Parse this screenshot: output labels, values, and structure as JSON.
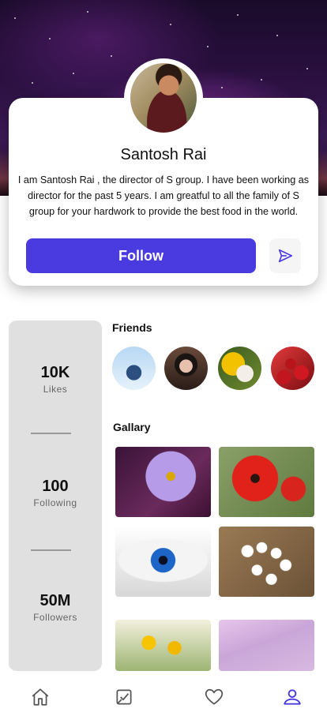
{
  "profile": {
    "name": "Santosh Rai",
    "bio": "I am Santosh Rai , the director of S group. I have been working as director for the past 5 years. I am greatful to all the family of S group for your hardwork to provide the best food in the world.",
    "follow_label": "Follow"
  },
  "stats": [
    {
      "value": "10K",
      "label": "Likes"
    },
    {
      "value": "100",
      "label": "Following"
    },
    {
      "value": "50M",
      "label": "Followers"
    }
  ],
  "friends": {
    "title": "Friends"
  },
  "gallery": {
    "title": "Gallary"
  },
  "tabs": [
    {
      "icon": "home-icon"
    },
    {
      "icon": "tasks-icon"
    },
    {
      "icon": "heart-icon"
    },
    {
      "icon": "profile-icon"
    }
  ],
  "colors": {
    "accent": "#4a3be0",
    "stats_panel": "#e0e0e0"
  }
}
